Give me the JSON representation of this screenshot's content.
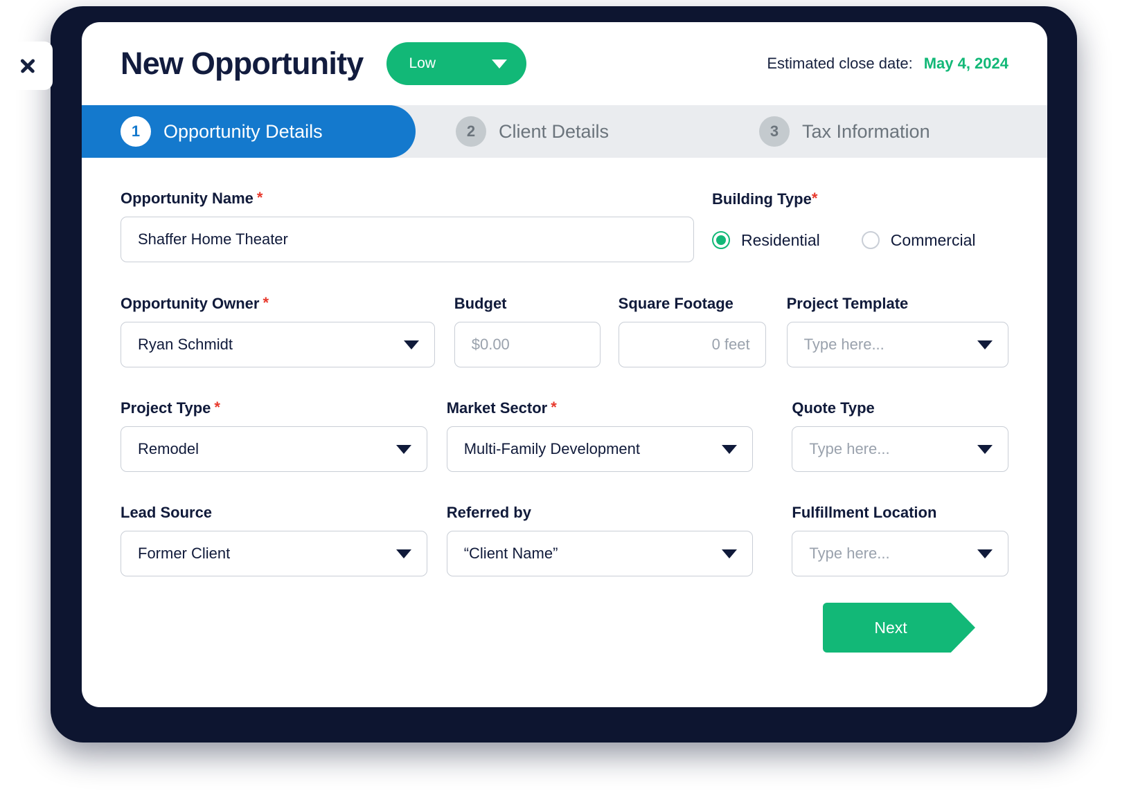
{
  "window": {
    "close_icon": "close-icon"
  },
  "header": {
    "title": "New Opportunity",
    "priority_value": "Low",
    "priority_caret_icon": "chevron-down-icon",
    "close_date_label": "Estimated close date:",
    "close_date_value": "May 4, 2024",
    "accent_green": "#12b877",
    "accent_blue": "#1479cd",
    "title_color": "#121c3e"
  },
  "stepper": {
    "steps": [
      {
        "number": "1",
        "label": "Opportunity Details",
        "active": true
      },
      {
        "number": "2",
        "label": "Client Details",
        "active": false
      },
      {
        "number": "3",
        "label": "Tax Information",
        "active": false
      }
    ]
  },
  "form": {
    "opportunity_name": {
      "label": "Opportunity Name",
      "required_marker": "*",
      "value": "Shaffer Home Theater"
    },
    "building_type": {
      "label": "Building Type",
      "required_marker": "*",
      "options": [
        {
          "label": "Residential",
          "selected": true
        },
        {
          "label": "Commercial",
          "selected": false
        }
      ]
    },
    "opportunity_owner": {
      "label": "Opportunity Owner",
      "required_marker": "*",
      "value": "Ryan Schmidt",
      "caret_icon": "chevron-down-icon"
    },
    "budget": {
      "label": "Budget",
      "placeholder": "$0.00"
    },
    "square_footage": {
      "label": "Square Footage",
      "placeholder": "0 feet"
    },
    "project_template": {
      "label": "Project Template",
      "placeholder": "Type here...",
      "caret_icon": "chevron-down-icon"
    },
    "project_type": {
      "label": "Project Type",
      "required_marker": "*",
      "value": "Remodel",
      "caret_icon": "chevron-down-icon"
    },
    "market_sector": {
      "label": "Market Sector",
      "required_marker": "*",
      "value": "Multi-Family Development",
      "caret_icon": "chevron-down-icon"
    },
    "quote_type": {
      "label": "Quote Type",
      "placeholder": "Type here...",
      "caret_icon": "chevron-down-icon"
    },
    "lead_source": {
      "label": "Lead Source",
      "value": "Former Client",
      "caret_icon": "chevron-down-icon"
    },
    "referred_by": {
      "label": "Referred by",
      "value": "“Client Name”",
      "caret_icon": "chevron-down-icon"
    },
    "fulfillment_location": {
      "label": "Fulfillment Location",
      "placeholder": "Type here...",
      "caret_icon": "chevron-down-icon"
    }
  },
  "footer": {
    "next_label": "Next"
  }
}
